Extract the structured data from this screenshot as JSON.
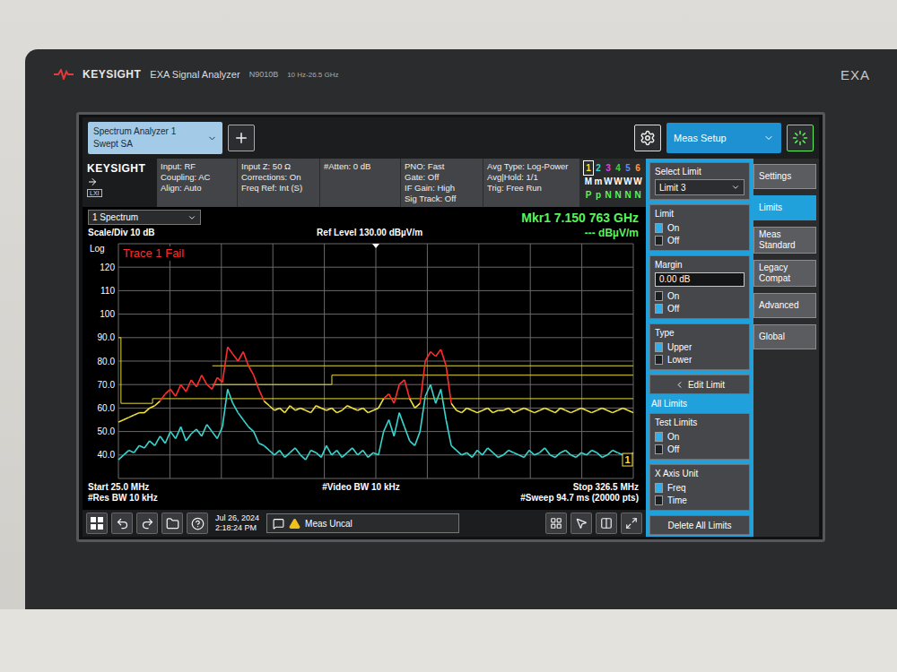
{
  "device": {
    "brand": "KEYSIGHT",
    "product": "EXA Signal Analyzer",
    "model": "N9010B",
    "range": "10 Hz-26.5 GHz",
    "badge": "EXA"
  },
  "tabs": [
    {
      "title": "Spectrum Analyzer 1",
      "subtitle": "Swept SA",
      "selected": true
    }
  ],
  "meas_menu": {
    "label": "Meas Setup"
  },
  "status": {
    "logo": "KEYSIGHT",
    "lxi": "LXI",
    "groups": [
      [
        "Input: RF",
        "Coupling: AC",
        "Align: Auto"
      ],
      [
        "Input Z: 50 Ω",
        "Corrections: On",
        "Freq Ref: Int (S)"
      ],
      [
        "#Atten: 0 dB"
      ],
      [
        "PNO: Fast",
        "Gate: Off",
        "IF Gain: High",
        "Sig Track: Off"
      ],
      [
        "Avg Type: Log-Power",
        "Avg|Hold: 1/1",
        "Trig: Free Run"
      ]
    ],
    "traces": [
      {
        "number": "1",
        "type": "M",
        "detector": "P",
        "color": "#f2e33a",
        "selected": true
      },
      {
        "number": "2",
        "type": "m",
        "detector": "p",
        "color": "#3fd6d0",
        "selected": false
      },
      {
        "number": "3",
        "type": "W",
        "detector": "N",
        "color": "#e040e0",
        "selected": false
      },
      {
        "number": "4",
        "type": "W",
        "detector": "N",
        "color": "#45d045",
        "selected": false
      },
      {
        "number": "5",
        "type": "W",
        "detector": "N",
        "color": "#5a8cff",
        "selected": false
      },
      {
        "number": "6",
        "type": "W",
        "detector": "N",
        "color": "#ff9a3c",
        "selected": false
      }
    ]
  },
  "window": {
    "title": "1 Spectrum"
  },
  "marker": {
    "label": "Mkr1 7.150 763 GHz",
    "value": "--- dBµV/m",
    "flag": "1"
  },
  "scale": {
    "scale_div": "Scale/Div 10 dB",
    "ref_level": "Ref Level 130.00 dBµV/m",
    "mode": "Log"
  },
  "chart": {
    "y_max": 130,
    "y_min": 30,
    "x_start": 25,
    "x_stop": 326.5,
    "y_ticks": [
      "120",
      "110",
      "100",
      "90.0",
      "80.0",
      "70.0",
      "60.0",
      "50.0",
      "40.0"
    ],
    "verdict": "Trace 1 Fail",
    "series": [
      {
        "name": "Trace 1",
        "color": "#f2e33a",
        "fail_color": "#ff2d2d",
        "values": [
          54,
          55,
          56,
          57,
          58,
          58,
          60,
          61,
          63,
          66,
          68,
          65,
          70,
          67,
          72,
          69,
          74,
          70,
          68,
          73,
          71,
          86,
          83,
          80,
          84,
          78,
          74,
          68,
          63,
          61,
          59,
          60,
          58,
          61,
          59,
          60,
          59,
          58,
          61,
          60,
          59,
          60,
          58,
          59,
          61,
          60,
          59,
          60,
          58,
          59,
          60,
          64,
          66,
          62,
          70,
          72,
          64,
          60,
          62,
          80,
          84,
          82,
          85,
          78,
          62,
          59,
          58,
          60,
          59,
          58,
          59,
          60,
          58,
          59,
          59,
          60,
          58,
          59,
          60,
          59,
          58,
          59,
          60,
          59,
          58,
          60,
          59,
          58,
          59,
          60,
          59,
          58,
          59,
          60,
          59,
          58,
          59,
          60,
          59,
          58
        ]
      },
      {
        "name": "Trace 2",
        "color": "#39d5cf",
        "values": [
          38,
          40,
          42,
          41,
          44,
          43,
          46,
          44,
          48,
          45,
          50,
          47,
          52,
          46,
          49,
          51,
          48,
          53,
          50,
          47,
          52,
          68,
          62,
          58,
          55,
          52,
          50,
          45,
          44,
          42,
          40,
          42,
          39,
          41,
          43,
          40,
          38,
          42,
          41,
          39,
          44,
          40,
          42,
          39,
          41,
          43,
          40,
          42,
          39,
          41,
          40,
          50,
          55,
          48,
          58,
          52,
          46,
          44,
          50,
          65,
          70,
          62,
          68,
          55,
          44,
          42,
          40,
          41,
          39,
          42,
          40,
          43,
          41,
          39,
          40,
          42,
          41,
          40,
          39,
          42,
          40,
          41,
          43,
          40,
          39,
          41,
          42,
          40,
          39,
          41,
          40,
          42,
          41,
          39,
          40,
          42,
          41,
          40,
          39,
          41
        ]
      }
    ],
    "limits": [
      {
        "name": "Limit 1",
        "tested": true,
        "points": [
          [
            25,
            90
          ],
          [
            26.5,
            90
          ],
          [
            26.5,
            62
          ],
          [
            45,
            62
          ],
          [
            45,
            64
          ],
          [
            326.5,
            64
          ]
        ]
      },
      {
        "name": "Limit 2",
        "tested": false,
        "points": [
          [
            80,
            70
          ],
          [
            150,
            70
          ],
          [
            150,
            74
          ],
          [
            326.5,
            74
          ]
        ]
      },
      {
        "name": "Limit 3",
        "tested": false,
        "points": [
          [
            80,
            78
          ],
          [
            326.5,
            78
          ]
        ]
      }
    ]
  },
  "footer": {
    "start": "Start 25.0 MHz",
    "video_bw": "#Video BW 10 kHz",
    "stop": "Stop 326.5 MHz",
    "res_bw": "#Res BW 10 kHz",
    "sweep": "#Sweep 94.7 ms (20000 pts)"
  },
  "taskbar": {
    "date": "Jul 26, 2024",
    "time": "2:18:24 PM",
    "message": "Meas Uncal"
  },
  "menu": {
    "items": [
      {
        "kind": "select",
        "label": "Select Limit",
        "value": "Limit 3"
      },
      {
        "kind": "radio",
        "label": "Limit",
        "options": [
          {
            "label": "On",
            "selected": true
          },
          {
            "label": "Off",
            "selected": false
          }
        ]
      },
      {
        "kind": "field",
        "label": "Margin",
        "value": "0.00 dB",
        "options": [
          {
            "label": "On",
            "selected": false
          },
          {
            "label": "Off",
            "selected": true
          }
        ]
      },
      {
        "kind": "radio",
        "label": "Type",
        "options": [
          {
            "label": "Upper",
            "selected": true
          },
          {
            "label": "Lower",
            "selected": false
          }
        ]
      },
      {
        "kind": "back",
        "label": "Edit Limit"
      },
      {
        "kind": "heading",
        "label": "All Limits"
      },
      {
        "kind": "radio",
        "label": "Test Limits",
        "options": [
          {
            "label": "On",
            "selected": true
          },
          {
            "label": "Off",
            "selected": false
          }
        ]
      },
      {
        "kind": "radio",
        "label": "X Axis Unit",
        "options": [
          {
            "label": "Freq",
            "selected": true
          },
          {
            "label": "Time",
            "selected": false
          }
        ]
      },
      {
        "kind": "button",
        "label": "Delete All Limits"
      }
    ]
  },
  "side_tabs": [
    {
      "label": "Settings",
      "selected": false
    },
    {
      "label": "Limits",
      "selected": true
    },
    {
      "label": "Meas Standard",
      "selected": false
    },
    {
      "label": "Legacy Compat",
      "selected": false
    },
    {
      "label": "Advanced",
      "selected": false
    },
    {
      "label": "Global",
      "selected": false
    }
  ]
}
